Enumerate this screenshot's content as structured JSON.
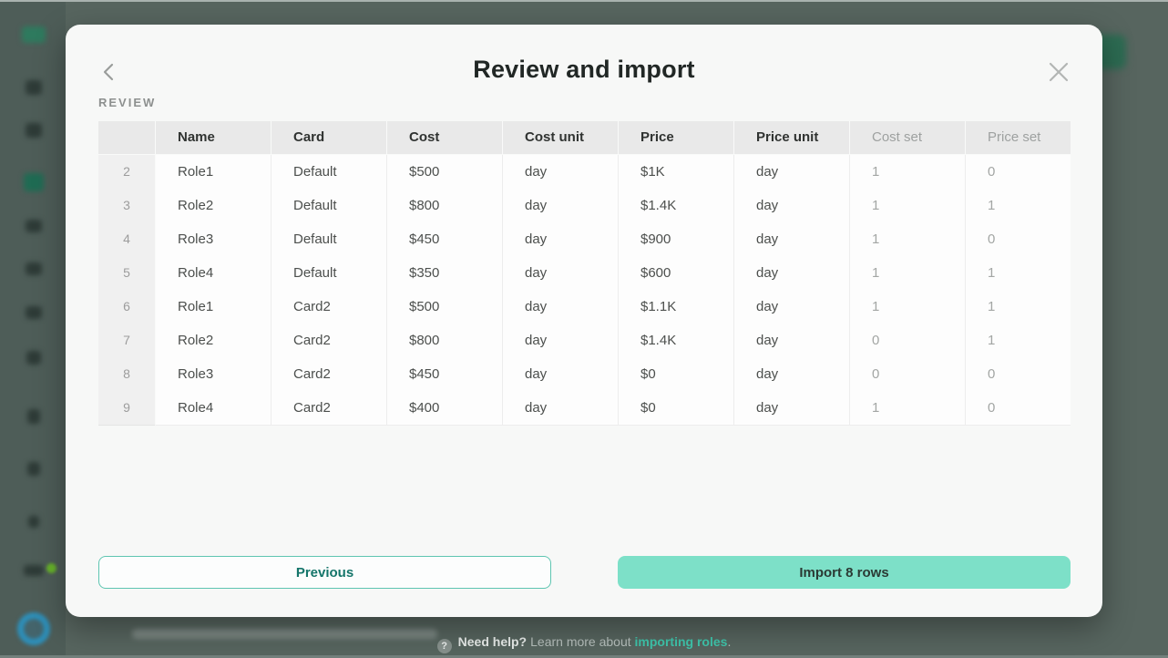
{
  "modal": {
    "title": "Review and import",
    "section_label": "REVIEW",
    "buttons": {
      "previous": "Previous",
      "import": "Import 8 rows"
    }
  },
  "table": {
    "headers": [
      "",
      "Name",
      "Card",
      "Cost",
      "Cost unit",
      "Price",
      "Price unit",
      "Cost set",
      "Price set"
    ],
    "rows": [
      {
        "num": "2",
        "name": "Role1",
        "card": "Default",
        "cost": "$500",
        "cost_unit": "day",
        "price": "$1K",
        "price_unit": "day",
        "cost_set": "1",
        "price_set": "0"
      },
      {
        "num": "3",
        "name": "Role2",
        "card": "Default",
        "cost": "$800",
        "cost_unit": "day",
        "price": "$1.4K",
        "price_unit": "day",
        "cost_set": "1",
        "price_set": "1"
      },
      {
        "num": "4",
        "name": "Role3",
        "card": "Default",
        "cost": "$450",
        "cost_unit": "day",
        "price": "$900",
        "price_unit": "day",
        "cost_set": "1",
        "price_set": "0"
      },
      {
        "num": "5",
        "name": "Role4",
        "card": "Default",
        "cost": "$350",
        "cost_unit": "day",
        "price": "$600",
        "price_unit": "day",
        "cost_set": "1",
        "price_set": "1"
      },
      {
        "num": "6",
        "name": "Role1",
        "card": "Card2",
        "cost": "$500",
        "cost_unit": "day",
        "price": "$1.1K",
        "price_unit": "day",
        "cost_set": "1",
        "price_set": "1"
      },
      {
        "num": "7",
        "name": "Role2",
        "card": "Card2",
        "cost": "$800",
        "cost_unit": "day",
        "price": "$1.4K",
        "price_unit": "day",
        "cost_set": "0",
        "price_set": "1"
      },
      {
        "num": "8",
        "name": "Role3",
        "card": "Card2",
        "cost": "$450",
        "cost_unit": "day",
        "price": "$0",
        "price_unit": "day",
        "cost_set": "0",
        "price_set": "0"
      },
      {
        "num": "9",
        "name": "Role4",
        "card": "Card2",
        "cost": "$400",
        "cost_unit": "day",
        "price": "$0",
        "price_unit": "day",
        "cost_set": "1",
        "price_set": "0"
      }
    ]
  },
  "footer": {
    "help_icon": "?",
    "help_bold": "Need help?",
    "help_text": "Learn more about",
    "link_text": "importing roles",
    "suffix": "."
  },
  "colors": {
    "accent_mint": "#7de0c8",
    "accent_teal_text": "#15756a",
    "link_teal": "#3fc7ad",
    "overlay_background": "#57655f",
    "sidebar_background": "#4e5d58",
    "modal_background": "#f7f8f7",
    "table_header_background": "#e9e9e9"
  }
}
